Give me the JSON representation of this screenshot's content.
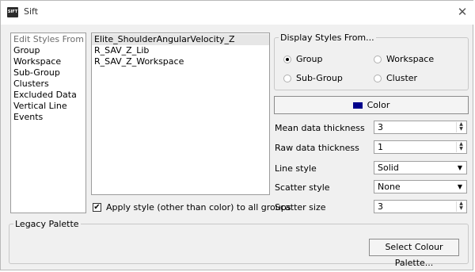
{
  "window": {
    "title": "Sift",
    "app_icon_text": "SIFT",
    "close_glyph": "✕"
  },
  "left_list": {
    "header": "Edit Styles From",
    "items": [
      "Group",
      "Workspace",
      "Sub-Group",
      "Clusters",
      "Excluded Data",
      "Vertical Line",
      "Events"
    ]
  },
  "group_list": {
    "items": [
      "Elite_ShoulderAngularVelocity_Z",
      "R_SAV_Z_Lib",
      "R_SAV_Z_Workspace"
    ]
  },
  "apply_checkbox": {
    "label": "Apply style (other than color) to all groups",
    "checked": true,
    "mark": "✔"
  },
  "display_styles": {
    "legend": "Display Styles From...",
    "options": [
      {
        "label": "Group",
        "selected": true
      },
      {
        "label": "Workspace",
        "selected": false
      },
      {
        "label": "Sub-Group",
        "selected": false
      },
      {
        "label": "Cluster",
        "selected": false
      }
    ]
  },
  "color_button": {
    "label": "Color",
    "swatch": "#00008b"
  },
  "properties": {
    "mean_thickness": {
      "label": "Mean data thickness",
      "value": "3"
    },
    "raw_thickness": {
      "label": "Raw data thickness",
      "value": "1"
    },
    "line_style": {
      "label": "Line style",
      "value": "Solid"
    },
    "scatter_style": {
      "label": "Scatter style",
      "value": "None"
    },
    "scatter_size": {
      "label": "Scatter size",
      "value": "3"
    }
  },
  "legacy_palette": {
    "legend": "Legacy Palette",
    "button": "Select Colour Palette..."
  },
  "glyphs": {
    "up": "▲",
    "down": "▼"
  }
}
